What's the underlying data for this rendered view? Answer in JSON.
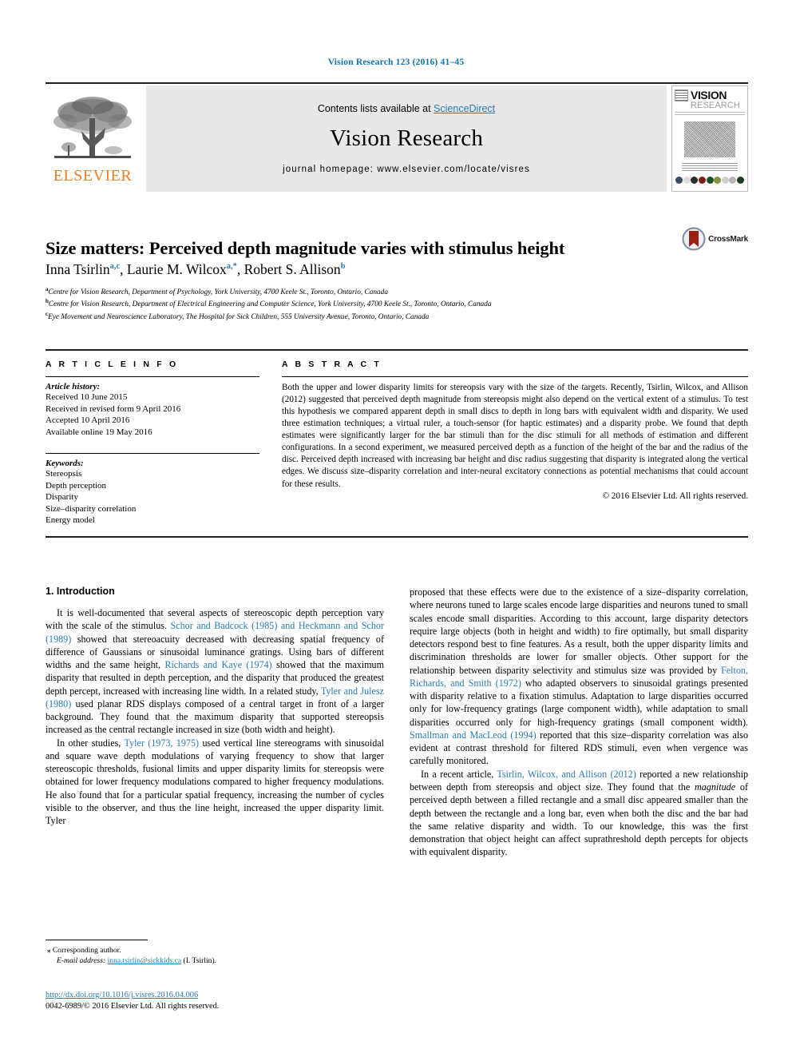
{
  "running_head": "Vision Research 123 (2016) 41–45",
  "masthead": {
    "publisher_name": "ELSEVIER",
    "contents_prefix": "Contents lists available at ",
    "contents_link": "ScienceDirect",
    "journal_title": "Vision Research",
    "homepage": "journal homepage: www.elsevier.com/locate/visres",
    "cover": {
      "line1": "VISION",
      "line2": "RESEARCH",
      "circle_colors": [
        "#3b4a6b",
        "#d9d9d9",
        "#2b2b2b",
        "#7a1f18",
        "#1f4d2b",
        "#8a8f3a",
        "#cfcfcf",
        "#b8b8b8",
        "#1d3b1f"
      ]
    }
  },
  "article": {
    "title": "Size matters: Perceived depth magnitude varies with stimulus height",
    "crossmark_label": "CrossMark",
    "authors": [
      {
        "name": "Inna Tsirlin",
        "marks": "a,c"
      },
      {
        "name": "Laurie M. Wilcox",
        "marks": "a,*"
      },
      {
        "name": "Robert S. Allison",
        "marks": "b"
      }
    ],
    "affiliations": [
      {
        "mark": "a",
        "text": "Centre for Vision Research, Department of Psychology, York University, 4700 Keele St., Toronto, Ontario, Canada"
      },
      {
        "mark": "b",
        "text": "Centre for Vision Research, Department of Electrical Engineering and Computer Science, York University, 4700 Keele St., Toronto, Ontario, Canada"
      },
      {
        "mark": "c",
        "text": "Eye Movement and Neuroscience Laboratory, The Hospital for Sick Children, 555 University Avenue, Toronto, Ontario, Canada"
      }
    ]
  },
  "article_info": {
    "heading": "A R T I C L E  I N F O",
    "history_label": "Article history:",
    "history": [
      "Received 10 June 2015",
      "Received in revised form 9 April 2016",
      "Accepted 10 April 2016",
      "Available online 19 May 2016"
    ],
    "keywords_label": "Keywords:",
    "keywords": [
      "Stereopsis",
      "Depth perception",
      "Disparity",
      "Size–disparity correlation",
      "Energy model"
    ]
  },
  "abstract": {
    "heading": "A B S T R A C T",
    "text": "Both the upper and lower disparity limits for stereopsis vary with the size of the targets. Recently, Tsirlin, Wilcox, and Allison (2012) suggested that perceived depth magnitude from stereopsis might also depend on the vertical extent of a stimulus. To test this hypothesis we compared apparent depth in small discs to depth in long bars with equivalent width and disparity. We used three estimation techniques; a virtual ruler, a touch-sensor (for haptic estimates) and a disparity probe. We found that depth estimates were significantly larger for the bar stimuli than for the disc stimuli for all methods of estimation and different configurations. In a second experiment, we measured perceived depth as a function of the height of the bar and the radius of the disc. Perceived depth increased with increasing bar height and disc radius suggesting that disparity is integrated along the vertical edges. We discuss size–disparity correlation and inter-neural excitatory connections as potential mechanisms that could account for these results.",
    "copyright": "© 2016 Elsevier Ltd. All rights reserved."
  },
  "introduction": {
    "heading": "1. Introduction",
    "left_paragraphs": [
      {
        "parts": [
          {
            "t": "It is well-documented that several aspects of stereoscopic depth perception vary with the scale of the stimulus. ",
            "k": "plain"
          },
          {
            "t": "Schor and Badcock (1985) and Heckmann and Schor (1989)",
            "k": "cite"
          },
          {
            "t": " showed that stereoacuity decreased with decreasing spatial frequency of difference of Gaussians or sinusoidal luminance gratings. Using bars of different widths and the same height, ",
            "k": "plain"
          },
          {
            "t": "Richards and Kaye (1974)",
            "k": "cite"
          },
          {
            "t": " showed that the maximum disparity that resulted in depth perception, and the disparity that produced the greatest depth percept, increased with increasing line width. In a related study, ",
            "k": "plain"
          },
          {
            "t": "Tyler and Julesz (1980)",
            "k": "cite"
          },
          {
            "t": " used planar RDS displays composed of a central target in front of a larger background. They found that the maximum disparity that supported stereopsis increased as the central rectangle increased in size (both width and height).",
            "k": "plain"
          }
        ]
      },
      {
        "parts": [
          {
            "t": "In other studies, ",
            "k": "plain"
          },
          {
            "t": "Tyler (1973, 1975)",
            "k": "cite"
          },
          {
            "t": " used vertical line stereograms with sinusoidal and square wave depth modulations of varying frequency to show that larger stereoscopic thresholds, fusional limits and upper disparity limits for stereopsis were obtained for lower frequency modulations compared to higher frequency modulations. He also found that for a particular spatial frequency, increasing the number of cycles visible to the observer, and thus the line height, increased the upper disparity limit. Tyler",
            "k": "plain"
          }
        ]
      }
    ],
    "right_paragraphs": [
      {
        "continuation": true,
        "parts": [
          {
            "t": "proposed that these effects were due to the existence of a size–disparity correlation, where neurons tuned to large scales encode large disparities and neurons tuned to small scales encode small disparities. According to this account, large disparity detectors require large objects (both in height and width) to fire optimally, but small disparity detectors respond best to fine features. As a result, both the upper disparity limits and discrimination thresholds are lower for smaller objects. Other support for the relationship between disparity selectivity and stimulus size was provided by ",
            "k": "plain"
          },
          {
            "t": "Felton, Richards, and Smith (1972)",
            "k": "cite"
          },
          {
            "t": " who adapted observers to sinusoidal gratings presented with disparity relative to a fixation stimulus. Adaptation to large disparities occurred only for low-frequency gratings (large component width), while adaptation to small disparities occurred only for high-frequency gratings (small component width). ",
            "k": "plain"
          },
          {
            "t": "Smallman and MacLeod (1994)",
            "k": "cite"
          },
          {
            "t": " reported that this size–disparity correlation was also evident at contrast threshold for filtered RDS stimuli, even when vergence was carefully monitored.",
            "k": "plain"
          }
        ]
      },
      {
        "continuation": false,
        "parts": [
          {
            "t": "In a recent article, ",
            "k": "plain"
          },
          {
            "t": "Tsirlin, Wilcox, and Allison (2012)",
            "k": "cite"
          },
          {
            "t": " reported a new relationship between depth from stereopsis and object size. They found that the ",
            "k": "plain"
          },
          {
            "t": "magnitude",
            "k": "italic"
          },
          {
            "t": " of perceived depth between a filled rectangle and a small disc appeared smaller than the depth between the rectangle and a long bar, even when both the disc and the bar had the same relative disparity and width. To our knowledge, this was the first demonstration that object height can affect suprathreshold depth percepts for objects with equivalent disparity.",
            "k": "plain"
          }
        ]
      }
    ]
  },
  "footnotes": {
    "corresponding_mark": "⁎",
    "corresponding_text": "Corresponding author.",
    "email_label": "E-mail address:",
    "email": "inna.tsirlin@sickkids.ca",
    "email_suffix": "(I. Tsirlin).",
    "doi": "http://dx.doi.org/10.1016/j.visres.2016.04.006",
    "issn_line": "0042-6989/© 2016 Elsevier Ltd. All rights reserved."
  }
}
